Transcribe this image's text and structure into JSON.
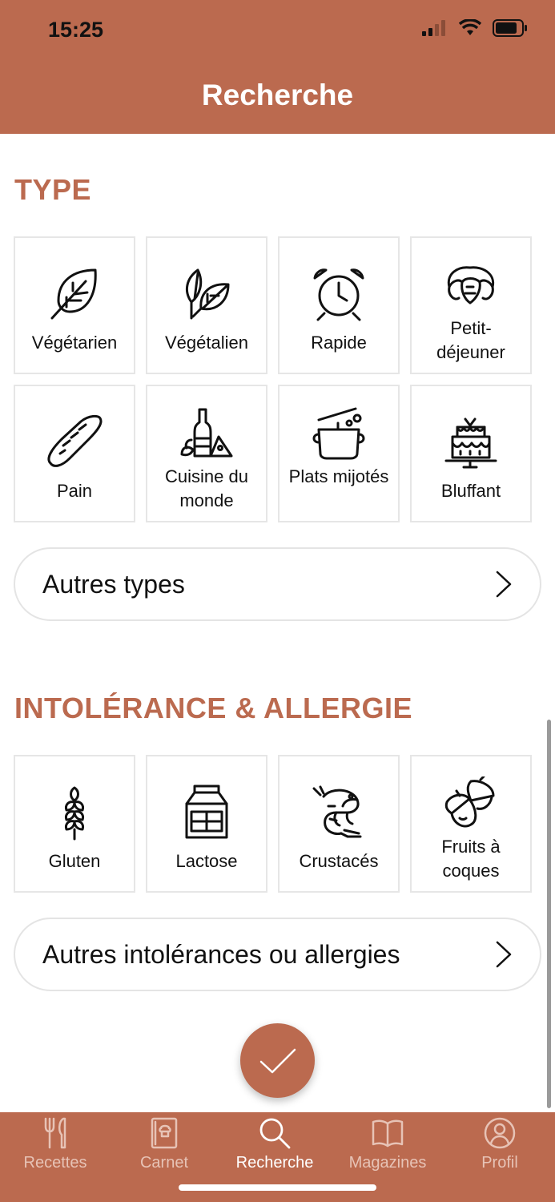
{
  "status_bar": {
    "time": "15:25"
  },
  "header": {
    "title": "Recherche"
  },
  "type_section": {
    "title": "TYPE",
    "tiles": [
      {
        "label": "Végétarien",
        "icon": "leaf-icon"
      },
      {
        "label": "Végétalien",
        "icon": "double-leaf-icon"
      },
      {
        "label": "Rapide",
        "icon": "alarm-clock-icon"
      },
      {
        "label": "Petit-déjeuner",
        "icon": "croissant-icon"
      },
      {
        "label": "Pain",
        "icon": "baguette-icon"
      },
      {
        "label": "Cuisine du monde",
        "icon": "bottle-cheese-icon"
      },
      {
        "label": "Plats mijotés",
        "icon": "stew-pot-icon"
      },
      {
        "label": "Bluffant",
        "icon": "cake-icon"
      }
    ],
    "more_label": "Autres types"
  },
  "allergy_section": {
    "title": "INTOLÉRANCE & ALLERGIE",
    "tiles": [
      {
        "label": "Gluten",
        "icon": "wheat-icon"
      },
      {
        "label": "Lactose",
        "icon": "milk-carton-icon"
      },
      {
        "label": "Crustacés",
        "icon": "shrimp-icon"
      },
      {
        "label": "Fruits à coques",
        "icon": "acorn-icon"
      }
    ],
    "more_label": "Autres intolérances ou allergies"
  },
  "tabbar": {
    "tabs": [
      {
        "label": "Recettes",
        "icon": "fork-knife-icon"
      },
      {
        "label": "Carnet",
        "icon": "notebook-icon"
      },
      {
        "label": "Recherche",
        "icon": "search-icon",
        "active": true
      },
      {
        "label": "Magazines",
        "icon": "open-book-icon"
      },
      {
        "label": "Profil",
        "icon": "user-icon"
      }
    ]
  },
  "colors": {
    "accent": "#bb6a4f",
    "tile_border": "#e6e6e6",
    "text": "#111111"
  }
}
